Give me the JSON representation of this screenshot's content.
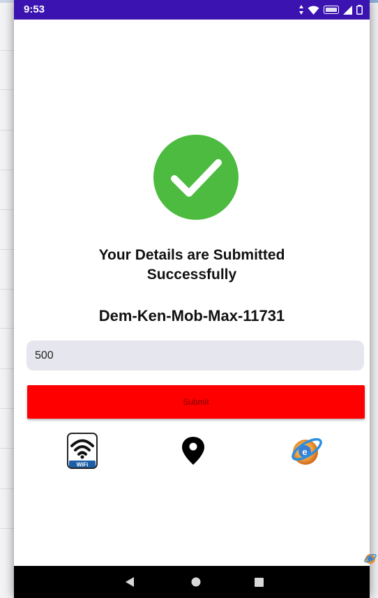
{
  "status_bar": {
    "time": "9:53",
    "color": "#3b13b0"
  },
  "success": {
    "check_icon": "check-circle-icon",
    "check_color": "#4cbb3f",
    "message": "Your Details are Submitted Successfully",
    "reference_code": "Dem-Ken-Mob-Max-11731"
  },
  "amount_input": {
    "value": "500"
  },
  "submit_button": {
    "label": "Submit",
    "color": "#ff0000"
  },
  "bottom_icons": [
    {
      "name": "wifi-icon",
      "label": "WiFi"
    },
    {
      "name": "location-pin-icon"
    },
    {
      "name": "internet-explorer-icon"
    }
  ],
  "nav_bar": {
    "back": "back-icon",
    "home": "home-icon",
    "recents": "recents-icon"
  }
}
